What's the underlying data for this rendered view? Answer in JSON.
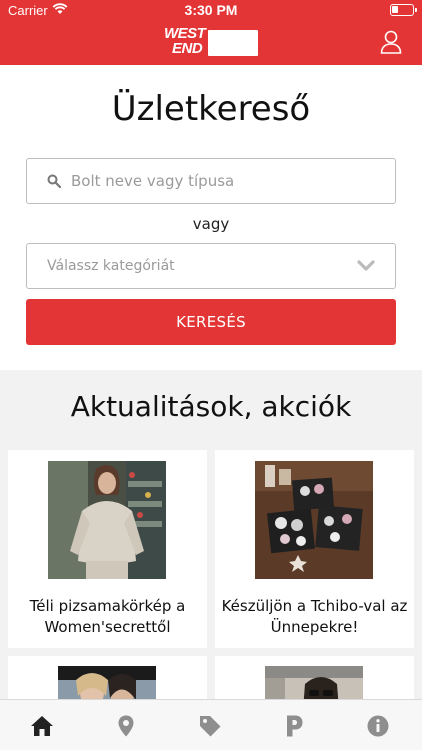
{
  "status_bar": {
    "carrier": "Carrier",
    "time": "3:30 PM"
  },
  "header": {
    "logo_line1": "WEST",
    "logo_line2": "END",
    "brand_color": "#e33535"
  },
  "store_finder": {
    "title": "Üzletkereső",
    "search_placeholder": "Bolt neve vagy típusa",
    "or_text": "vagy",
    "category_placeholder": "Válassz kategóriát",
    "search_button": "KERESÉS"
  },
  "news": {
    "title": "Aktualitások, akciók",
    "cards": [
      {
        "caption": "Téli pizsamakörkép a Women'secrettől"
      },
      {
        "caption": "Készüljön a Tchibo-val az Ünnepekre!"
      },
      {
        "caption": ""
      },
      {
        "caption": ""
      }
    ]
  },
  "tabbar": {
    "tabs": [
      {
        "icon": "home-icon",
        "active": true
      },
      {
        "icon": "location-pin-icon",
        "active": false
      },
      {
        "icon": "tag-icon",
        "active": false
      },
      {
        "icon": "parking-icon",
        "active": false
      },
      {
        "icon": "info-icon",
        "active": false
      }
    ]
  }
}
